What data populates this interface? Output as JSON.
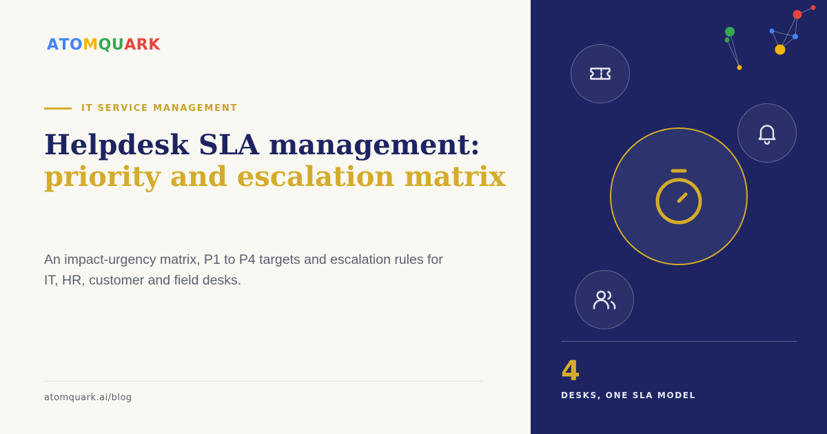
{
  "brand": {
    "logo_letters": [
      {
        "char": "A",
        "color": "#4285f4"
      },
      {
        "char": "T",
        "color": "#4285f4"
      },
      {
        "char": "O",
        "color": "#4285f4"
      },
      {
        "char": "M",
        "color": "#f5b400"
      },
      {
        "char": "Q",
        "color": "#34a853"
      },
      {
        "char": "U",
        "color": "#34a853"
      },
      {
        "char": "A",
        "color": "#e8453c"
      },
      {
        "char": "R",
        "color": "#e8453c"
      },
      {
        "char": "K",
        "color": "#e8453c"
      }
    ]
  },
  "hero": {
    "eyebrow": "IT SERVICE MANAGEMENT",
    "title_line1": "Helpdesk SLA management:",
    "title_line2": "priority and escalation matrix",
    "description": "An impact-urgency matrix, P1 to P4 targets and escalation rules for IT, HR, customer and field desks."
  },
  "footer": {
    "url": "atomquark.ai/blog"
  },
  "panel": {
    "icons": [
      "ticket-icon",
      "bell-icon",
      "stopwatch-icon",
      "users-icon"
    ],
    "stat_value": "4",
    "stat_label": "DESKS, ONE SLA MODEL"
  },
  "colors": {
    "navy": "#1e2461",
    "gold": "#d4ac2b",
    "cream": "#faf8f3",
    "text_gray": "#5a5f6e"
  }
}
